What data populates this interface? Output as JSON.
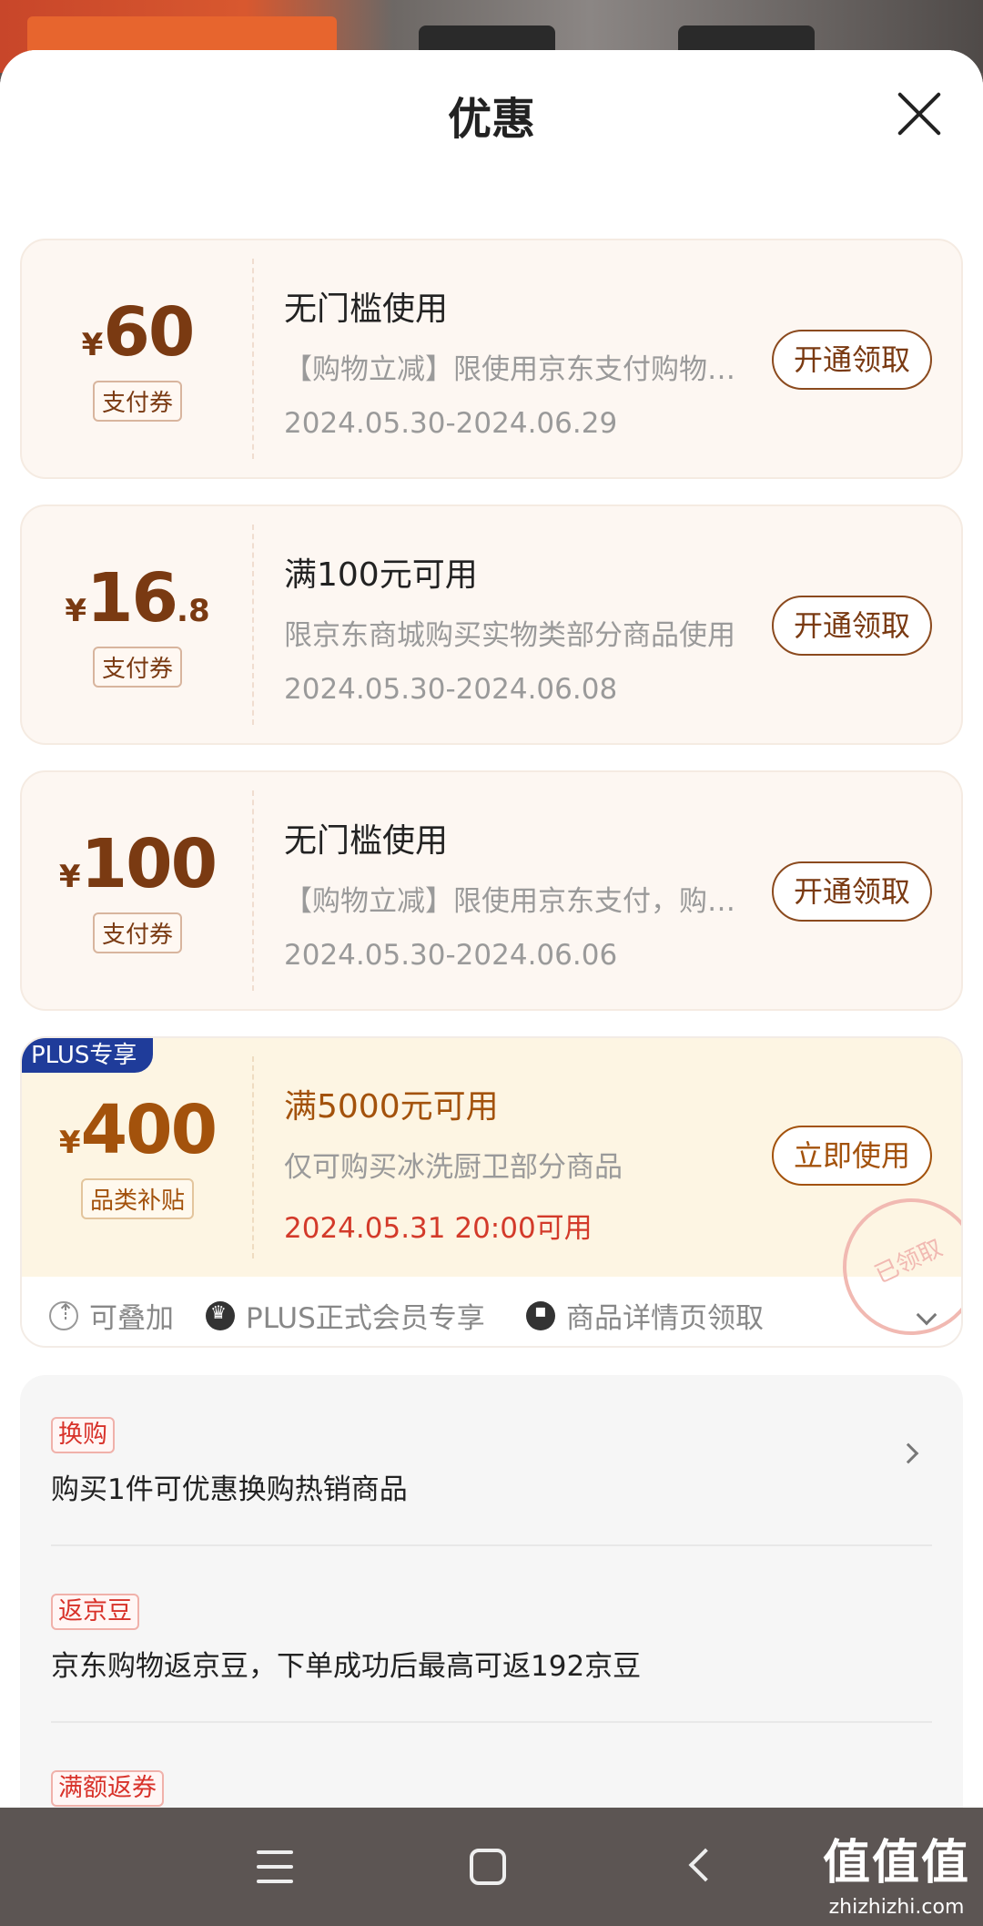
{
  "sheet": {
    "title": "优惠"
  },
  "coupons": [
    {
      "yen": "¥",
      "amount": "60",
      "decimal": "",
      "type_tag": "支付券",
      "condition": "无门槛使用",
      "desc": "【购物立减】限使用京东支付购物抵扣",
      "validity": "2024.05.30-2024.06.29",
      "action": "开通领取"
    },
    {
      "yen": "¥",
      "amount": "16",
      "decimal": ".8",
      "type_tag": "支付券",
      "condition": "满100元可用",
      "desc": "限京东商城购买实物类部分商品使用",
      "validity": "2024.05.30-2024.06.08",
      "action": "开通领取"
    },
    {
      "yen": "¥",
      "amount": "100",
      "decimal": "",
      "type_tag": "支付券",
      "condition": "无门槛使用",
      "desc": "【购物立减】限使用京东支付，购物抵扣",
      "validity": "2024.05.30-2024.06.06",
      "action": "开通领取"
    }
  ],
  "plus_coupon": {
    "badge": "PLUS专享",
    "yen": "¥",
    "amount": "400",
    "type_tag": "品类补贴",
    "condition": "满5000元可用",
    "desc": "仅可购买冰洗厨卫部分商品",
    "validity": "2024.05.31 20:00可用",
    "action": "立即使用",
    "stamp": "已领取",
    "features": [
      "可叠加",
      "PLUS正式会员专享",
      "商品详情页领取"
    ]
  },
  "promos": [
    {
      "tag": "换购",
      "text": "购买1件可优惠换购热销商品"
    },
    {
      "tag": "返京豆",
      "text": "京东购物返京豆，下单成功后最高可返192京豆"
    },
    {
      "tag": "满额返券",
      "text": ""
    }
  ],
  "watermark": {
    "logo": "值值值",
    "url": "zhizhizhi.com"
  }
}
